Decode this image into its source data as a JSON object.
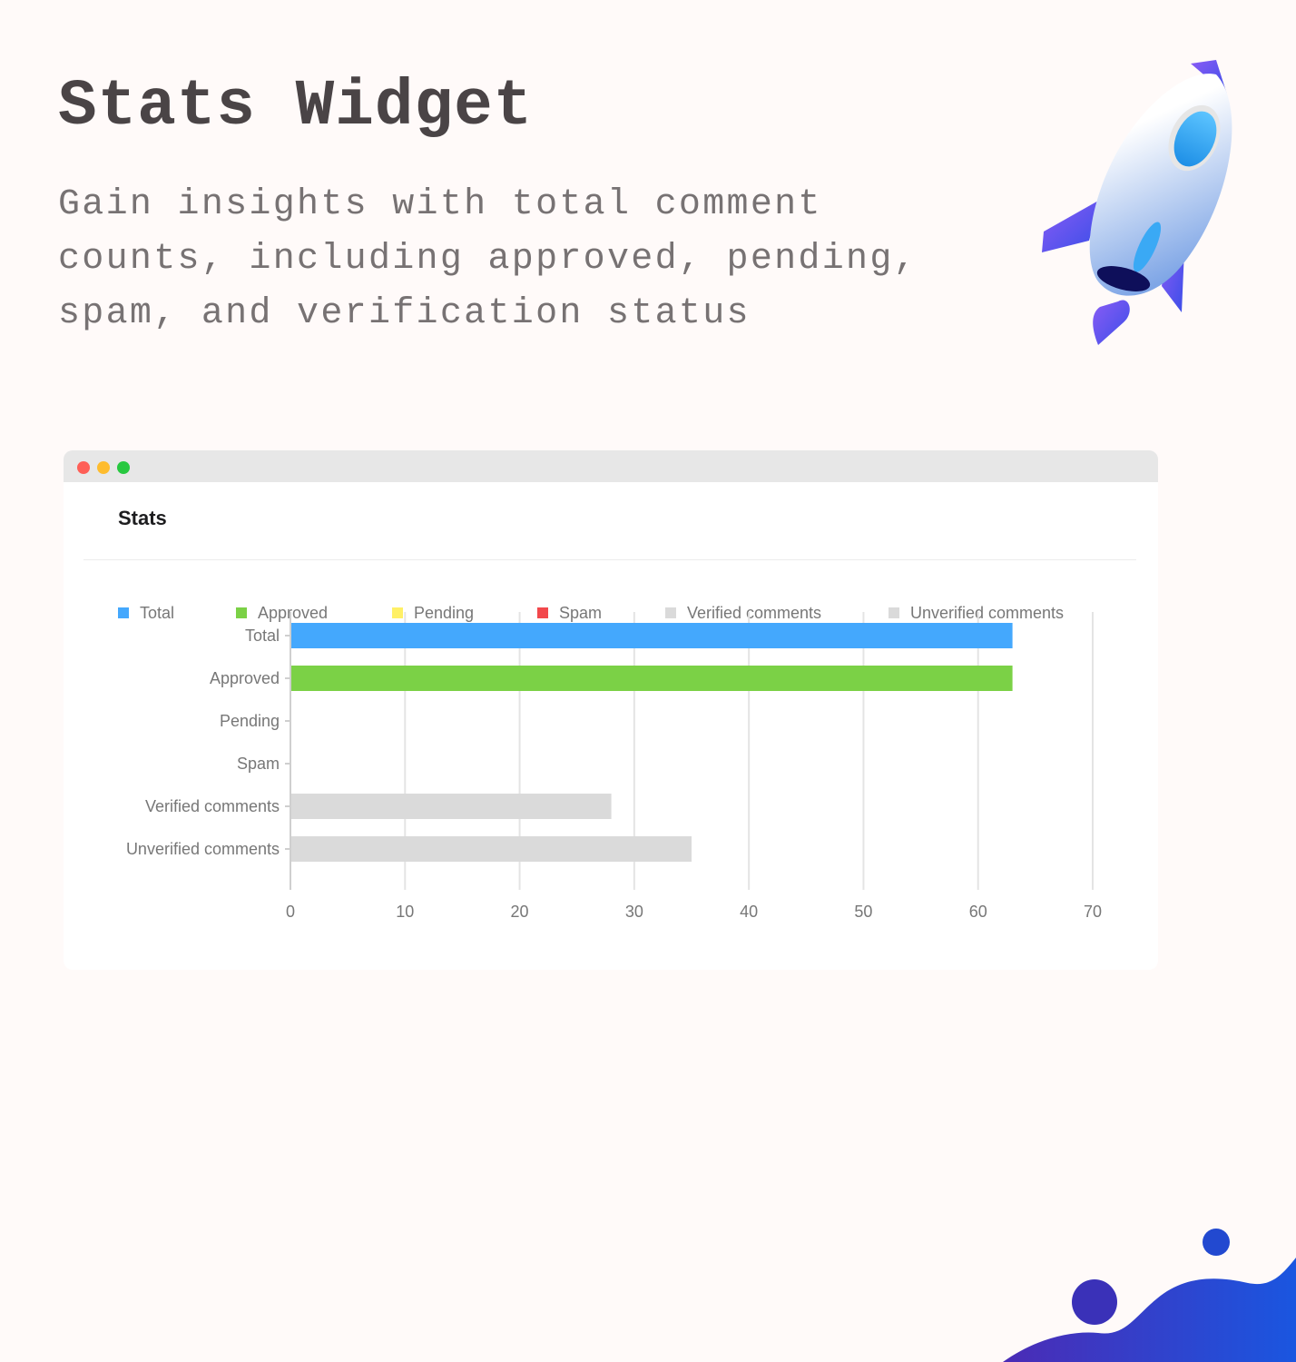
{
  "hero": {
    "title": "Stats Widget",
    "subtitle": "Gain insights with total comment counts, including approved, pending, spam, and verification status"
  },
  "decorations": {
    "illustration": "rocket-icon",
    "corner_shape": "wave-blob"
  },
  "window": {
    "controls": [
      "close",
      "minimize",
      "maximize"
    ],
    "title": "Stats"
  },
  "chart_data": {
    "type": "bar",
    "orientation": "horizontal",
    "title": "Stats",
    "xlabel": "",
    "ylabel": "",
    "categories": [
      "Total",
      "Approved",
      "Pending",
      "Spam",
      "Verified comments",
      "Unverified comments"
    ],
    "series": [
      {
        "name": "Total",
        "color": "#44a8fd",
        "values": [
          63,
          null,
          null,
          null,
          null,
          null
        ]
      },
      {
        "name": "Approved",
        "color": "#7bd146",
        "values": [
          null,
          63,
          null,
          null,
          null,
          null
        ]
      },
      {
        "name": "Pending",
        "color": "#fff066",
        "values": [
          null,
          null,
          0,
          null,
          null,
          null
        ]
      },
      {
        "name": "Spam",
        "color": "#f2484c",
        "values": [
          null,
          null,
          null,
          0,
          null,
          null
        ]
      },
      {
        "name": "Verified comments",
        "color": "#dadada",
        "values": [
          null,
          null,
          null,
          null,
          28,
          null
        ]
      },
      {
        "name": "Unverified comments",
        "color": "#dadada",
        "values": [
          null,
          null,
          null,
          null,
          null,
          35
        ]
      }
    ],
    "values": [
      63,
      63,
      0,
      0,
      28,
      35
    ],
    "xlim": [
      0,
      70
    ],
    "xticks": [
      0,
      10,
      20,
      30,
      40,
      50,
      60,
      70
    ],
    "grid": true,
    "legend": {
      "placement": "top",
      "entries": [
        "Total",
        "Approved",
        "Pending",
        "Spam",
        "Verified comments",
        "Unverified comments"
      ]
    }
  }
}
